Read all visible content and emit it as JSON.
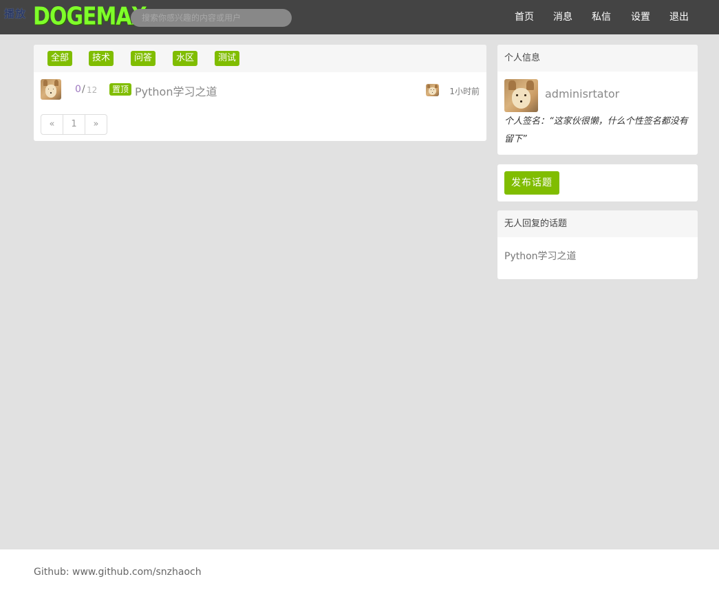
{
  "brand": {
    "cn_label": "播放",
    "logo": "DOGEMAX"
  },
  "search": {
    "placeholder": "搜索你感兴趣的内容或用户"
  },
  "nav": [
    "首页",
    "消息",
    "私信",
    "设置",
    "退出"
  ],
  "tabs": [
    "全部",
    "技术",
    "问答",
    "水区",
    "测试"
  ],
  "topics": [
    {
      "replies": "0",
      "separator": "/",
      "visits": "12",
      "badge": "置顶",
      "title": "Python学习之道",
      "time": "1小时前"
    }
  ],
  "pagination": {
    "prev": "«",
    "page": "1",
    "next": "»"
  },
  "sidebar": {
    "profile_header": "个人信息",
    "username": "adminisrtator",
    "signature": "个人签名：“这家伙很懒，什么个性签名都没有留下”",
    "post_button": "发布话题",
    "unreplied_header": "无人回复的话题",
    "unreplied_topics": [
      "Python学习之道"
    ]
  },
  "footer": {
    "text": "Github: www.github.com/snzhaoch"
  },
  "colors": {
    "accent": "#80bd01",
    "navbar": "#444444",
    "background": "#e1e1e1",
    "logo": "#7fff2a"
  }
}
